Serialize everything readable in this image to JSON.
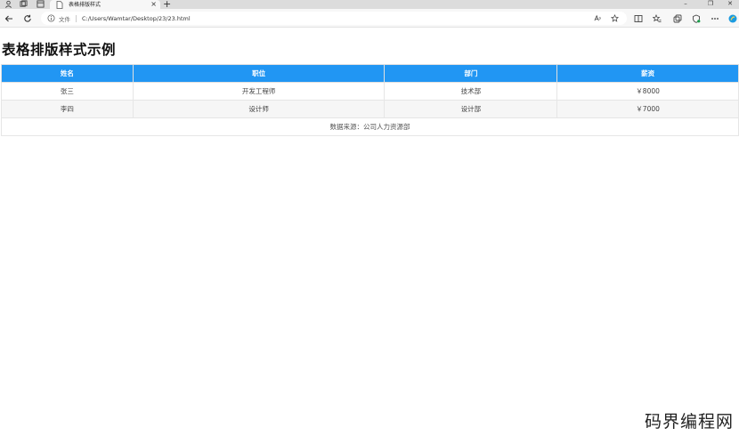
{
  "browser": {
    "tab": {
      "title": "表格排版样式",
      "close": "×"
    },
    "new_tab": "+",
    "window": {
      "minimize": "–",
      "restore": "❐",
      "close": "✕"
    },
    "address": {
      "label": "文件",
      "url": "C:/Users/Wamtar/Desktop/23/23.html"
    }
  },
  "page": {
    "title": "表格排版样式示例",
    "table": {
      "headers": [
        "姓名",
        "职位",
        "部门",
        "薪资"
      ],
      "rows": [
        [
          "张三",
          "开发工程师",
          "技术部",
          "￥8000"
        ],
        [
          "李四",
          "设计师",
          "设计部",
          "￥7000"
        ]
      ],
      "footer": "数据来源：公司人力资源部"
    }
  },
  "watermark": "码界编程网",
  "colors": {
    "header_bg": "#2196f3",
    "header_text": "#ffffff"
  }
}
